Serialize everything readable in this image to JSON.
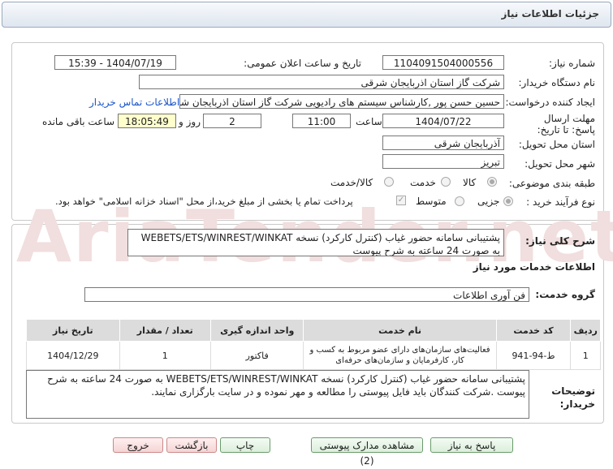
{
  "header": {
    "title": "جزئیات اطلاعات نیاز"
  },
  "watermark": "AriaTender.net",
  "form": {
    "need_number_label": "شماره نیاز:",
    "need_number": "1104091504000556",
    "announce_label": "تاریخ و ساعت اعلان عمومی:",
    "announce_value": "1404/07/19 - 15:39",
    "buyer_org_label": "نام دستگاه خریدار:",
    "buyer_org": "شرکت گاز استان اذربایجان شرقی",
    "creator_label": "ایجاد کننده درخواست:",
    "creator": "حسین حسن پور ,کارشناس سیستم های رادیویی  شرکت گاز استان اذربایجان شرقی",
    "contact_link": "اطلاعات تماس خریدار",
    "deadline_label": "مهلت ارسال پاسخ: تا تاریخ:",
    "deadline_date": "1404/07/22",
    "time_label": "ساعت",
    "deadline_time": "11:00",
    "days_value": "2",
    "days_label": "روز و",
    "remaining_time": "18:05:49",
    "remaining_label": "ساعت باقی مانده",
    "province_label": "استان محل تحویل:",
    "province": "آذربایجان شرقی",
    "city_label": "شهر محل تحویل:",
    "city": "تبریز",
    "category_label": "طبقه بندی موضوعی:",
    "category_options": [
      "کالا",
      "خدمت",
      "کالا/خدمت"
    ],
    "process_label": "نوع فرآیند خرید :",
    "process_options": [
      "جزیی",
      "متوسط"
    ],
    "payment_note": "پرداخت تمام یا بخشی از مبلغ خرید،از محل \"اسناد خزانه اسلامی\" خواهد بود."
  },
  "summary": {
    "label": "شرح کلی نیاز:",
    "text": "پشتیبانی سامانه حضور غیاب (کنترل کارکرد) نسخه WEBETS/ETS/WINREST/WINKAT به صورت 24 ساعته به شرح پیوست"
  },
  "services": {
    "section_title": "اطلاعات خدمات مورد نیاز",
    "group_label": "گروه خدمت:",
    "group_value": "فن آوری اطلاعات",
    "columns": [
      "ردیف",
      "کد خدمت",
      "نام خدمت",
      "واحد اندازه گیری",
      "تعداد / مقدار",
      "تاریخ نیاز"
    ],
    "rows": [
      [
        "1",
        "ط-94-941",
        "فعالیت‌های سازمان‌های دارای عضو مربوط به کسب و کار، کارفرمایان و سازمان‌های حرفه‌ای",
        "فاکتور",
        "1",
        "1404/12/29"
      ]
    ]
  },
  "buyer_notes": {
    "label": "توضیحات خریدار:",
    "text": "پشتیبانی سامانه حضور غیاب (کنترل کارکرد) نسخه WEBETS/ETS/WINREST/WINKAT به صورت 24 ساعته به شرح پیوست .شرکت کنندگان باید فایل پیوستی را مطالعه و مهر نموده و در سایت بارگزاری نمایند."
  },
  "buttons": {
    "reply": "پاسخ به نیاز",
    "attachments": "مشاهده مدارک پیوستی (2)",
    "print": "چاپ",
    "back": "بازگشت",
    "exit": "خروج"
  }
}
